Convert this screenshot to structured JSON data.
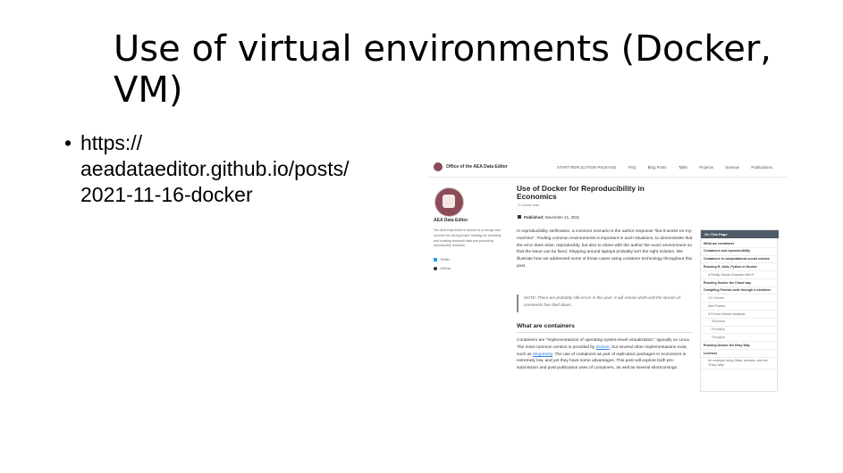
{
  "slide": {
    "title": "Use of virtual environments (Docker, VM)",
    "bullet_marker": "•",
    "bullet_lines": [
      "https://",
      "aeadataeditor.github.io/posts/",
      "2021-11-16-docker"
    ]
  },
  "screenshot": {
    "site_title": "Office of the AEA Data Editor",
    "nav": [
      "START REPLICATION PACKAGE",
      "FAQ",
      "Blog Posts",
      "Talks",
      "Projects",
      "Surveys",
      "Publications"
    ],
    "sidebar": {
      "name": "AEA Data Editor",
      "description": "The AEA Data Editor's mission is to design and oversee the AEA journals' strategy for archiving and curating research data and promoting reproducible research.",
      "links": [
        "Twitter",
        "GitHub"
      ]
    },
    "post": {
      "title": "Use of Docker for Reproducibility in Economics",
      "read_time": "21 minute read",
      "published_label": "Published:",
      "published_date": "November 21, 2021",
      "intro": "In reproducibility verification, a common scenario is the author response \"but-it-works-on-my-machine\". Finding common environments is important in such situations, to demonstrate that the error does arise, reproducibly, but also to share with the author the exact environment so that the issue can be fixed. Shipping around laptops probably isn't the right solution. We illustrate how we addressed some of those cases using container technology throughout this post.",
      "note": "NOTE: There are probably still errors in this post. It will remain draft until the stream of comments has died down...",
      "section_heading": "What are containers",
      "containers_a": "Containers are \"implementations of operating system-level virtualization,\" typically on Linux. The most common version is provided by ",
      "docker_link": "Docker",
      "containers_b": ", but several other implementations exist, such as ",
      "singularity_link": "Singularity",
      "containers_c": ". The use of containers as part of replication packages in economics is extremely low, and yet they have some advantages. This post will explore both pre-submission and post-publication uses of containers, as well as several shortcomings."
    },
    "toc": {
      "header": "On This Page",
      "items": [
        {
          "label": "What are containers",
          "level": 0
        },
        {
          "label": "Containers and reproducibility",
          "level": 0
        },
        {
          "label": "Containers in computational social science",
          "level": 0
        },
        {
          "label": "Running R, Julia, Python in Docker",
          "level": 0
        },
        {
          "label": "A Really Simple Example with R",
          "level": 1
        },
        {
          "label": "Running Docker the Cloud way",
          "level": 0
        },
        {
          "label": "Compiling Fortran code through a container",
          "level": 0
        },
        {
          "label": "CC Fortran",
          "level": 1
        },
        {
          "label": "Intel Fortran",
          "level": 1
        },
        {
          "label": "A Fortran Docker Analysis",
          "level": 1
        },
        {
          "label": "Simplicity",
          "level": 2
        },
        {
          "label": "Flexibility",
          "level": 2
        },
        {
          "label": "Thoughts",
          "level": 2
        },
        {
          "label": "Running Docker the Easy Way",
          "level": 0
        },
        {
          "label": "Licenses",
          "level": 0
        },
        {
          "label": "An example using Stata, licenses, and the \"Easy Way\"",
          "level": 1
        }
      ]
    }
  }
}
